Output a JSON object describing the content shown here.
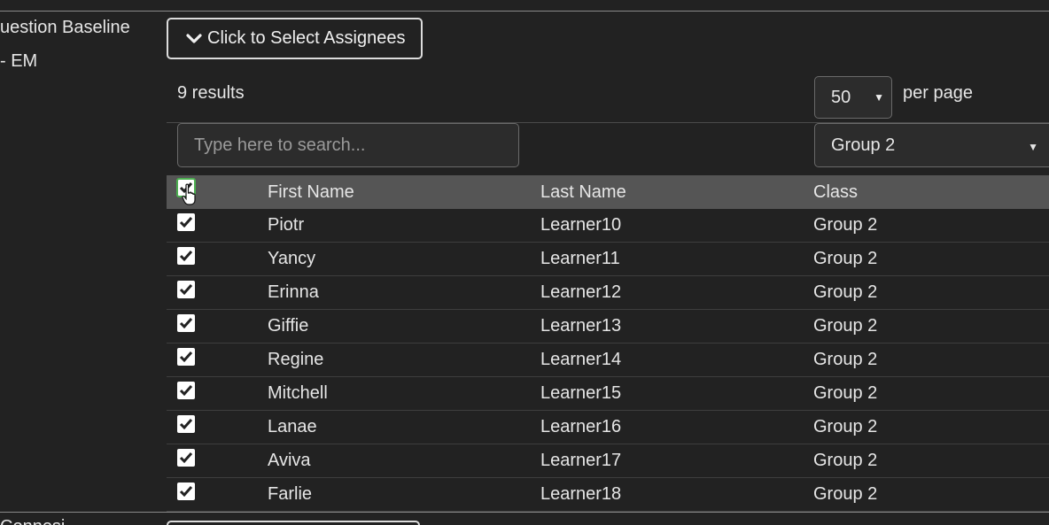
{
  "left_panel": {
    "line1": "uestion Baseline",
    "line2": "- EM",
    "bottom_partial": "Connesi"
  },
  "assign_button": {
    "label": "Click to Select Assignees",
    "icon": "chevron-down-icon"
  },
  "results": {
    "text": "9 results"
  },
  "pagination": {
    "per_page_value": "50",
    "per_page_label": "per page"
  },
  "search": {
    "placeholder": "Type here to search...",
    "value": ""
  },
  "class_filter": {
    "selected": "Group 2"
  },
  "table": {
    "headers": {
      "first_name": "First Name",
      "last_name": "Last Name",
      "class": "Class"
    },
    "rows": [
      {
        "first": "Piotr",
        "last": "Learner10",
        "class": "Group 2",
        "checked": true
      },
      {
        "first": "Yancy",
        "last": "Learner11",
        "class": "Group 2",
        "checked": true
      },
      {
        "first": "Erinna",
        "last": "Learner12",
        "class": "Group 2",
        "checked": true
      },
      {
        "first": "Giffie",
        "last": "Learner13",
        "class": "Group 2",
        "checked": true
      },
      {
        "first": "Regine",
        "last": "Learner14",
        "class": "Group 2",
        "checked": true
      },
      {
        "first": "Mitchell",
        "last": "Learner15",
        "class": "Group 2",
        "checked": true
      },
      {
        "first": "Lanae",
        "last": "Learner16",
        "class": "Group 2",
        "checked": true
      },
      {
        "first": "Aviva",
        "last": "Learner17",
        "class": "Group 2",
        "checked": true
      },
      {
        "first": "Farlie",
        "last": "Learner18",
        "class": "Group 2",
        "checked": true
      }
    ]
  },
  "colors": {
    "background": "#222222",
    "header_row": "#555555",
    "checkbox_focus": "#4caf50"
  }
}
